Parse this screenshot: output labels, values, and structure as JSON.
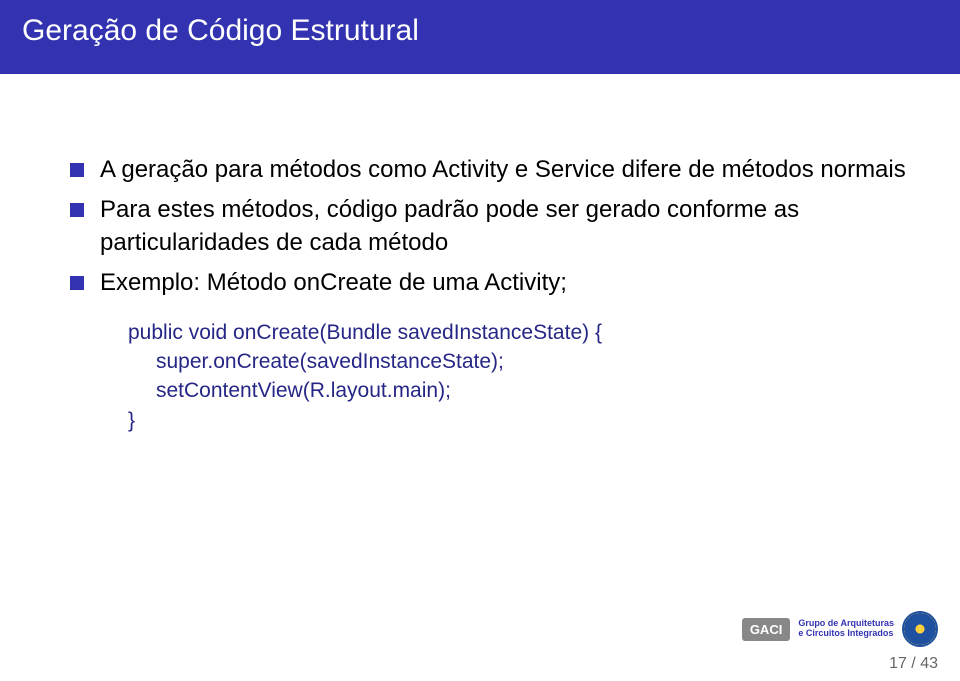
{
  "title": "Geração de Código Estrutural",
  "bullets": [
    "A geração para métodos como Activity e Service difere de métodos normais",
    "Para estes métodos, código padrão pode ser gerado conforme as particularidades de cada método",
    "Exemplo: Método onCreate de uma Activity;"
  ],
  "code": {
    "l1": "public void onCreate(Bundle savedInstanceState) {",
    "l2": "super.onCreate(savedInstanceState);",
    "l3": "setContentView(R.layout.main);",
    "l4": "}"
  },
  "logo": {
    "abbrev": "GACI",
    "line1": "Grupo de Arquiteturas",
    "line2": "e Circuitos Integrados"
  },
  "footer": "17 / 43"
}
